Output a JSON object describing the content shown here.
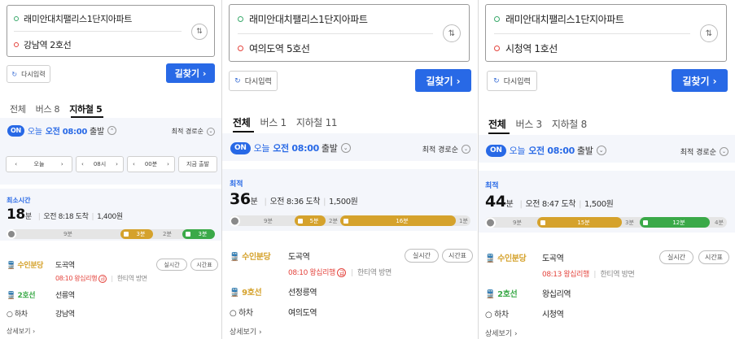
{
  "panels": [
    {
      "origin": "래미안대치팰리스1단지아파트",
      "destination": "강남역 2호선",
      "reset_label": "다시입력",
      "find_label": "길찾기 ›",
      "tabs": [
        "전체",
        "버스 8",
        "지하철 5"
      ],
      "on_label": "ON",
      "today_label": "오늘",
      "time_label": "오전 08:00",
      "depart_label": "출발",
      "sort_label": "최적 경로순",
      "stepper": {
        "day": "오늘",
        "hour": "08시",
        "minute": "00분",
        "now": "지금 출발"
      },
      "caption": "최소시간",
      "minutes": "18",
      "minute_unit": "분",
      "arrival": "오전 8:18 도착",
      "fare": "1,400원",
      "bar": {
        "walk1": "9분",
        "seg1": "3분",
        "walk2": "2분",
        "seg2": "3분"
      },
      "legs": [
        {
          "line": "수인분당",
          "station": "도곡역"
        },
        {
          "line": "2호선",
          "station": "선릉역"
        },
        {
          "line": "하차",
          "station": "강남역"
        }
      ],
      "arrival_info": {
        "time": "08:10",
        "train": "왕십리행",
        "badge": "급",
        "dir": "한티역 방면"
      },
      "realtime_label": "실시간",
      "timetable_label": "시간표",
      "more_label": "상세보기 ›"
    },
    {
      "origin": "래미안대치팰리스1단지아파트",
      "destination": "여의도역 5호선",
      "reset_label": "다시입력",
      "find_label": "길찾기 ›",
      "tabs": [
        "전체",
        "버스 1",
        "지하철 11"
      ],
      "on_label": "ON",
      "today_label": "오늘",
      "time_label": "오전 08:00",
      "depart_label": "출발",
      "sort_label": "최적 경로순",
      "caption": "최적",
      "minutes": "36",
      "minute_unit": "분",
      "arrival": "오전 8:36 도착",
      "fare": "1,500원",
      "bar": {
        "walk1": "9분",
        "seg1": "5분",
        "walk2": "2분",
        "seg2": "16분",
        "walk3": "1분"
      },
      "legs": [
        {
          "line": "수인분당",
          "station": "도곡역"
        },
        {
          "line": "9호선",
          "station": "선정릉역"
        },
        {
          "line": "하차",
          "station": "여의도역"
        }
      ],
      "arrival_info": {
        "time": "08:10",
        "train": "왕십리행",
        "badge": "급",
        "dir": "한티역 방면"
      },
      "realtime_label": "실시간",
      "timetable_label": "시간표",
      "more_label": "상세보기 ›"
    },
    {
      "origin": "래미안대치팰리스1단지아파트",
      "destination": "시청역 1호선",
      "reset_label": "다시입력",
      "find_label": "길찾기 ›",
      "tabs": [
        "전체",
        "버스 3",
        "지하철 8"
      ],
      "on_label": "ON",
      "today_label": "오늘",
      "time_label": "오전 08:00",
      "depart_label": "출발",
      "sort_label": "최적 경로순",
      "caption": "최적",
      "minutes": "44",
      "minute_unit": "분",
      "arrival": "오전 8:47 도착",
      "fare": "1,500원",
      "bar": {
        "walk1": "9분",
        "seg1": "15분",
        "walk2": "3분",
        "seg2": "12분",
        "walk3": "4분"
      },
      "legs": [
        {
          "line": "수인분당",
          "station": "도곡역"
        },
        {
          "line": "2호선",
          "station": "왕십리역"
        },
        {
          "line": "하차",
          "station": "시청역"
        }
      ],
      "arrival_info": {
        "time": "08:13",
        "train": "왕십리행",
        "dir": "한티역 방면"
      },
      "realtime_label": "실시간",
      "timetable_label": "시간표",
      "more_label": "상세보기 ›"
    }
  ],
  "icons": {
    "swap": "swap-arrows-icon",
    "reset": "refresh-icon",
    "chevron": "chevron-down-icon",
    "subway": "subway-train-icon",
    "walk": "walking-person-icon"
  },
  "colors": {
    "accent": "#2869e6",
    "suin_bundang": "#d5a22c",
    "line2": "#3aa948",
    "line9": "#d5a22c",
    "line1": "#3aa948",
    "arrival_red": "#e4443d"
  }
}
